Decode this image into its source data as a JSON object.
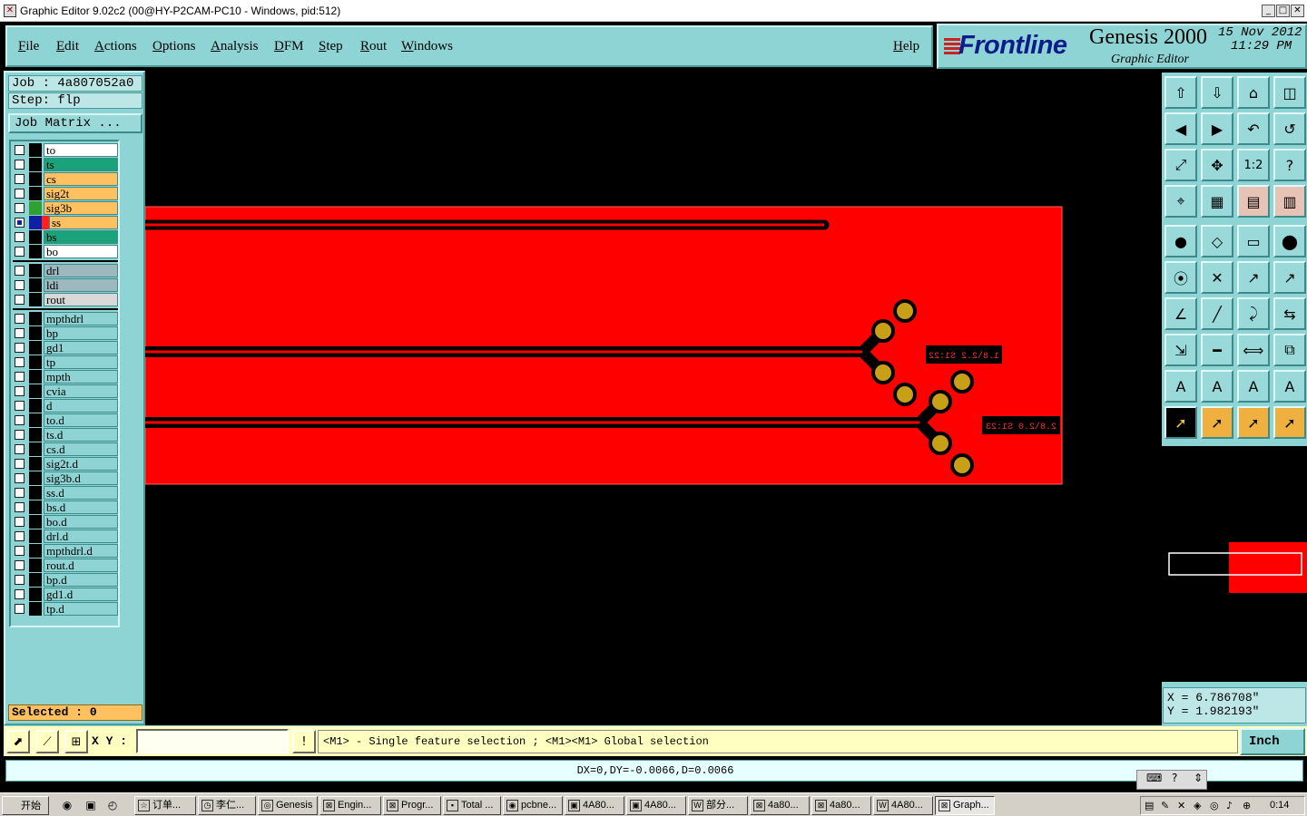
{
  "window": {
    "title": "Graphic Editor 9.02c2 (00@HY-P2CAM-PC10 - Windows, pid:512)",
    "min_label": "_",
    "max_label": "□",
    "close_label": "✕"
  },
  "menu": {
    "file": "File",
    "edit": "Edit",
    "actions": "Actions",
    "options": "Options",
    "analysis": "Analysis",
    "dfm": "DFM",
    "step": "Step",
    "rout": "Rout",
    "windows": "Windows",
    "help": "Help"
  },
  "brand": {
    "logo": "Frontline",
    "product": "Genesis 2000",
    "subtitle": "Graphic Editor",
    "date": "15 Nov 2012",
    "time": "11:29 PM"
  },
  "job": {
    "job_line": "Job : 4a807052a0",
    "step_line": "Step: flp",
    "matrix_button": "Job Matrix ..."
  },
  "layers": [
    {
      "name": "to",
      "bg": "#ffffff",
      "swatch": "#000000",
      "group": 1
    },
    {
      "name": "ts",
      "bg": "#1aa37a",
      "swatch": "#000000",
      "group": 1
    },
    {
      "name": "cs",
      "bg": "#ffc060",
      "swatch": "#000000",
      "group": 1
    },
    {
      "name": "sig2t",
      "bg": "#ffc060",
      "swatch": "#000000",
      "group": 1
    },
    {
      "name": "sig3b",
      "bg": "#ffc060",
      "swatch": "#30a030",
      "group": 1
    },
    {
      "name": "ss",
      "bg": "#ffc060",
      "swatch": "#ff2020",
      "group": 1,
      "active": true
    },
    {
      "name": "bs",
      "bg": "#1aa37a",
      "swatch": "#000000",
      "group": 1
    },
    {
      "name": "bo",
      "bg": "#ffffff",
      "swatch": "#000000",
      "group": 1
    },
    {
      "name": "drl",
      "bg": "#9eb8c0",
      "swatch": "#000000",
      "group": 2
    },
    {
      "name": "ldi",
      "bg": "#9eb8c0",
      "swatch": "#000000",
      "group": 2
    },
    {
      "name": "rout",
      "bg": "#d8d8d8",
      "swatch": "#000000",
      "group": 2
    },
    {
      "name": "mpthdrl",
      "bg": "#8fd4d4",
      "swatch": "#000000",
      "group": 3
    },
    {
      "name": "bp",
      "bg": "#8fd4d4",
      "swatch": "#000000",
      "group": 3
    },
    {
      "name": "gd1",
      "bg": "#8fd4d4",
      "swatch": "#000000",
      "group": 3
    },
    {
      "name": "tp",
      "bg": "#8fd4d4",
      "swatch": "#000000",
      "group": 3
    },
    {
      "name": "mpth",
      "bg": "#8fd4d4",
      "swatch": "#000000",
      "group": 3
    },
    {
      "name": "cvia",
      "bg": "#8fd4d4",
      "swatch": "#000000",
      "group": 3
    },
    {
      "name": "d",
      "bg": "#8fd4d4",
      "swatch": "#000000",
      "group": 3
    },
    {
      "name": "to.d",
      "bg": "#8fd4d4",
      "swatch": "#000000",
      "group": 3
    },
    {
      "name": "ts.d",
      "bg": "#8fd4d4",
      "swatch": "#000000",
      "group": 3
    },
    {
      "name": "cs.d",
      "bg": "#8fd4d4",
      "swatch": "#000000",
      "group": 3
    },
    {
      "name": "sig2t.d",
      "bg": "#8fd4d4",
      "swatch": "#000000",
      "group": 3
    },
    {
      "name": "sig3b.d",
      "bg": "#8fd4d4",
      "swatch": "#000000",
      "group": 3
    },
    {
      "name": "ss.d",
      "bg": "#8fd4d4",
      "swatch": "#000000",
      "group": 3
    },
    {
      "name": "bs.d",
      "bg": "#8fd4d4",
      "swatch": "#000000",
      "group": 3
    },
    {
      "name": "bo.d",
      "bg": "#8fd4d4",
      "swatch": "#000000",
      "group": 3
    },
    {
      "name": "drl.d",
      "bg": "#8fd4d4",
      "swatch": "#000000",
      "group": 3
    },
    {
      "name": "mpthdrl.d",
      "bg": "#8fd4d4",
      "swatch": "#000000",
      "group": 3
    },
    {
      "name": "rout.d",
      "bg": "#8fd4d4",
      "swatch": "#000000",
      "group": 3
    },
    {
      "name": "bp.d",
      "bg": "#8fd4d4",
      "swatch": "#000000",
      "group": 3
    },
    {
      "name": "gd1.d",
      "bg": "#8fd4d4",
      "swatch": "#000000",
      "group": 3
    },
    {
      "name": "tp.d",
      "bg": "#8fd4d4",
      "swatch": "#000000",
      "group": 3
    }
  ],
  "status": {
    "selected": "Selected : 0",
    "x": "X = 6.786708\"",
    "y": "Y = 1.982193\""
  },
  "canvas": {
    "board_color": "#ff0000",
    "pad_color": "#c8a018",
    "label1": "1.8\\2.2 S1:22",
    "label2": "2.8\\2.0 S1:23"
  },
  "command": {
    "xy_label": "X Y :",
    "xy_value": "",
    "bang": "!",
    "hint": "<M1> - Single feature selection ; <M1><M1> Global selection",
    "units": "Inch"
  },
  "measure": {
    "text": "DX=0,DY=-0.0066,D=0.0066",
    "help": "?"
  },
  "toolbar_icons": [
    "open-job-icon",
    "save-icon",
    "home-icon",
    "split-window-icon",
    "arrow-left-icon",
    "arrow-right-icon",
    "undo-icon",
    "redraw-icon",
    "zoom-fit-icon",
    "zoom-home-icon",
    "zoom-one-to-two-icon",
    "help-query-icon",
    "snap-icon",
    "grid-icon",
    "layer-display-icon",
    "layer-color-icon",
    "pad-icon",
    "surface-icon",
    "ruler-icon",
    "circle-pad-icon",
    "connect-icon",
    "delete-icon",
    "move-icon",
    "copy-icon",
    "line-icon",
    "slash-icon",
    "arc-icon",
    "mirror-icon",
    "transform-icon",
    "horizontal-icon",
    "measure-icon",
    "snap-group-icon",
    "text-a-icon",
    "text-b-icon",
    "text-c-icon",
    "text-d-icon",
    "select-pointer-icon",
    "select-arrow-icon",
    "select-rotate-icon",
    "select-step-icon"
  ],
  "toolbar_glyphs": [
    "⇧",
    "⇩",
    "⌂",
    "◫",
    "◀",
    "▶",
    "↶",
    "↺",
    "⤢",
    "✥",
    "1:2",
    "?",
    "⌖",
    "▦",
    "▤",
    "▥",
    "●",
    "◇",
    "▭",
    "⬤",
    "⦿",
    "✕",
    "↗",
    "↗",
    "∠",
    "╱",
    "⤸",
    "⇆",
    "⇲",
    "━",
    "⟺",
    "⧉",
    "A",
    "A",
    "A",
    "A",
    "➚",
    "➚",
    "➚",
    "➚"
  ],
  "taskbar": {
    "start": "开始",
    "clock": "0:14",
    "tasks": [
      {
        "label": "订单...",
        "icon": "☆"
      },
      {
        "label": "李仁...",
        "icon": "◷"
      },
      {
        "label": "Genesis",
        "icon": "◎"
      },
      {
        "label": "Engin...",
        "icon": "⊠"
      },
      {
        "label": "Progr...",
        "icon": "⊠"
      },
      {
        "label": "Total ...",
        "icon": "▪"
      },
      {
        "label": "pcbne...",
        "icon": "◉"
      },
      {
        "label": "4A80...",
        "icon": "▣"
      },
      {
        "label": "4A80...",
        "icon": "▣"
      },
      {
        "label": "部分...",
        "icon": "W"
      },
      {
        "label": "4a80...",
        "icon": "⊠"
      },
      {
        "label": "4a80...",
        "icon": "⊠"
      },
      {
        "label": "4A80...",
        "icon": "W"
      },
      {
        "label": "Graph...",
        "icon": "⊠"
      }
    ]
  }
}
